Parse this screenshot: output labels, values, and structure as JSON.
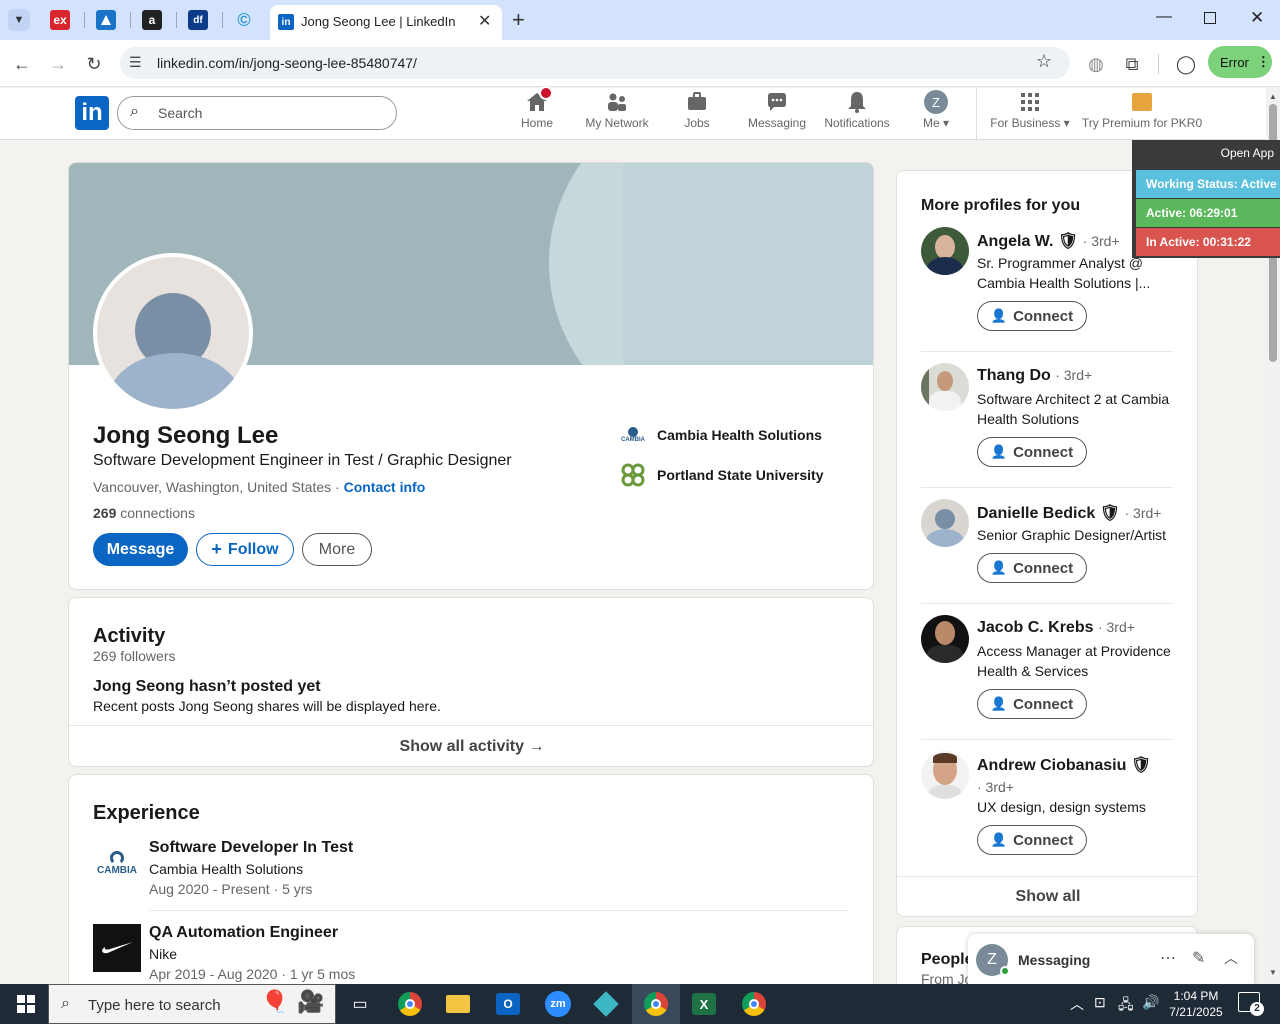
{
  "browser": {
    "tabs": [
      {
        "icon": "ex-tab-icon",
        "label": "ex"
      },
      {
        "icon": "blue-app-tab-icon",
        "label": ""
      },
      {
        "icon": "amazon-tab-icon",
        "label": "a"
      },
      {
        "icon": "df-tab-icon",
        "label": "df"
      },
      {
        "icon": "c-tab-icon",
        "label": "©"
      }
    ],
    "active_tab_title": "Jong Seong Lee | LinkedIn",
    "url": "linkedin.com/in/jong-seong-lee-85480747/",
    "profile_status": "Error"
  },
  "nav": {
    "search_placeholder": "Search",
    "notification_badge": "",
    "items": [
      {
        "label": "Home",
        "icon": "home-icon"
      },
      {
        "label": "My Network",
        "icon": "network-icon"
      },
      {
        "label": "Jobs",
        "icon": "jobs-icon"
      },
      {
        "label": "Messaging",
        "icon": "messaging-icon"
      },
      {
        "label": "Notifications",
        "icon": "bell-icon"
      },
      {
        "label": "Me",
        "icon": "avatar"
      }
    ],
    "avatar_letter": "Z",
    "for_business": "For Business",
    "premium": "Try Premium for PKR0"
  },
  "overlay": {
    "open_app": "Open App",
    "working_status": "Working Status: Active",
    "active": "Active: 06:29:01",
    "inactive": "In Active: 00:31:22"
  },
  "profile": {
    "name": "Jong Seong Lee",
    "headline": "Software Development Engineer in Test / Graphic Designer",
    "location": "Vancouver, Washington, United States",
    "separator": "·",
    "contact_info": "Contact info",
    "connections_count": "269",
    "connections_label": "connections",
    "company": "Cambia Health Solutions",
    "school": "Portland State University",
    "buttons": {
      "message": "Message",
      "follow": "Follow",
      "more": "More"
    }
  },
  "activity": {
    "title": "Activity",
    "followers": "269 followers",
    "empty_title": "Jong Seong hasn’t posted yet",
    "empty_desc": "Recent posts Jong Seong shares will be displayed here.",
    "show_all": "Show all activity →"
  },
  "experience": {
    "title": "Experience",
    "items": [
      {
        "title": "Software Developer In Test",
        "company": "Cambia Health Solutions",
        "dates": "Aug 2020 - Present · 5 yrs",
        "logo": "cambia-logo"
      },
      {
        "title": "QA Automation Engineer",
        "company": "Nike",
        "dates": "Apr 2019 - Aug 2020 · 1 yr 5 mos",
        "logo": "nike-logo"
      }
    ]
  },
  "sidebar": {
    "title": "More profiles for you",
    "profiles": [
      {
        "name": "Angela W.",
        "verified": true,
        "degree": "· 3rd+",
        "desc": "Sr. Programmer Analyst @ Cambia Health Solutions |...",
        "connect": "Connect"
      },
      {
        "name": "Thang Do",
        "verified": false,
        "degree": "· 3rd+",
        "desc": "Software Architect 2 at Cambia Health Solutions",
        "connect": "Connect"
      },
      {
        "name": "Danielle Bedick",
        "verified": true,
        "degree": "· 3rd+",
        "desc": "Senior Graphic Designer/Artist",
        "connect": "Connect"
      },
      {
        "name": "Jacob C. Krebs",
        "verified": false,
        "degree": "· 3rd+",
        "desc": "Access Manager at Providence Health & Services",
        "connect": "Connect"
      },
      {
        "name": "Andrew Ciobanasiu",
        "verified": true,
        "degree": "· 3rd+",
        "desc": "UX design, design systems",
        "connect": "Connect"
      }
    ],
    "show_all": "Show all",
    "people_title": "People",
    "people_sub": "From Jo"
  },
  "messaging": {
    "label": "Messaging",
    "avatar_letter": "Z"
  },
  "taskbar": {
    "search_placeholder": "Type here to search",
    "time": "1:04 PM",
    "date": "7/21/2025",
    "notification_count": "2"
  },
  "colors": {
    "linkedin_blue": "#0a66c2",
    "tab_bar": "#d3e3fd",
    "working": "#5bc0de",
    "active": "#5cb85c",
    "inactive": "#d9534f"
  }
}
